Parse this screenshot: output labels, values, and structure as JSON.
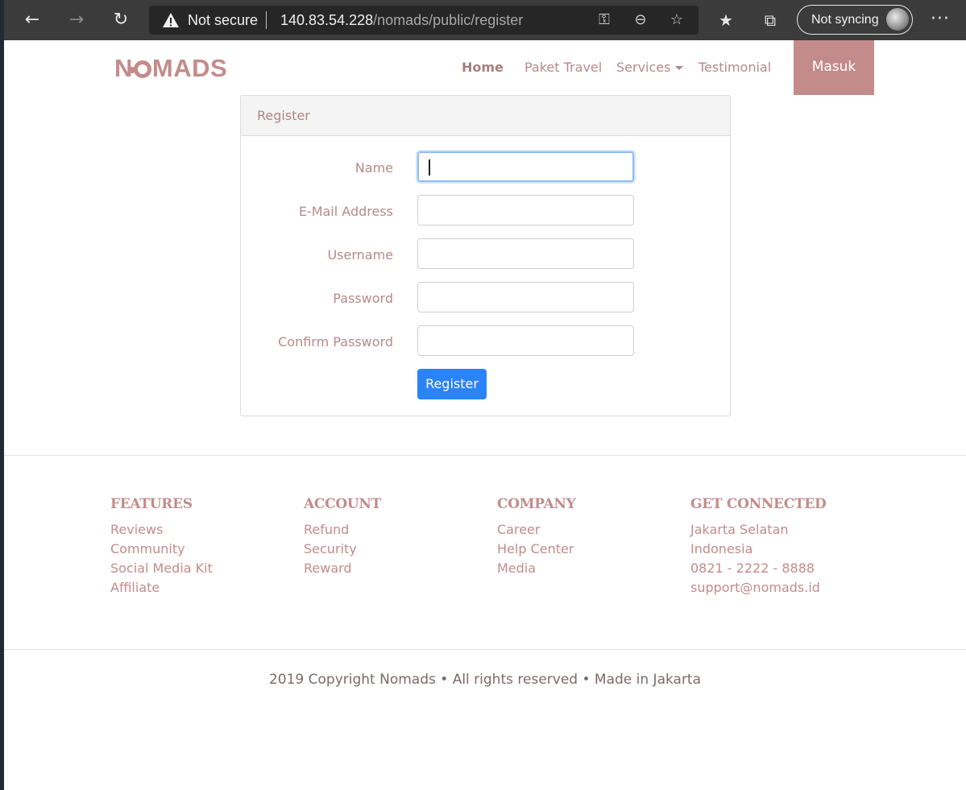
{
  "browser": {
    "security_label": "Not secure",
    "url_host": "140.83.54.228",
    "url_path": "/nomads/public/register",
    "sync_label": "Not syncing",
    "icons": [
      "back-icon",
      "forward-icon",
      "refresh-icon",
      "warning-icon",
      "key-icon",
      "zoom-out-icon",
      "add-favorite-icon",
      "favorites-icon",
      "collections-icon",
      "profile-avatar",
      "more-icon"
    ]
  },
  "site": {
    "logo_left": "N",
    "logo_right": "MADS",
    "nav": {
      "home": "Home",
      "paket_travel": "Paket Travel",
      "services": "Services",
      "testimonial": "Testimonial",
      "login": "Masuk"
    },
    "brand_color": "#c48b8b"
  },
  "register": {
    "title": "Register",
    "fields": {
      "name": "Name",
      "email": "E-Mail Address",
      "username": "Username",
      "password": "Password",
      "confirm": "Confirm Password"
    },
    "submit_label": "Register",
    "submit_color": "#2a84f8"
  },
  "footer": {
    "features": {
      "title": "FEATURES",
      "items": [
        "Reviews",
        "Community",
        "Social Media Kit",
        "Affiliate"
      ]
    },
    "account": {
      "title": "ACCOUNT",
      "items": [
        "Refund",
        "Security",
        "Reward"
      ]
    },
    "company": {
      "title": "COMPANY",
      "items": [
        "Career",
        "Help Center",
        "Media"
      ]
    },
    "connected": {
      "title": "GET CONNECTED",
      "items": [
        "Jakarta Selatan",
        "Indonesia",
        "0821 - 2222 - 8888",
        "support@nomads.id"
      ]
    },
    "copyright": "2019 Copyright Nomads • All rights reserved • Made in Jakarta"
  }
}
